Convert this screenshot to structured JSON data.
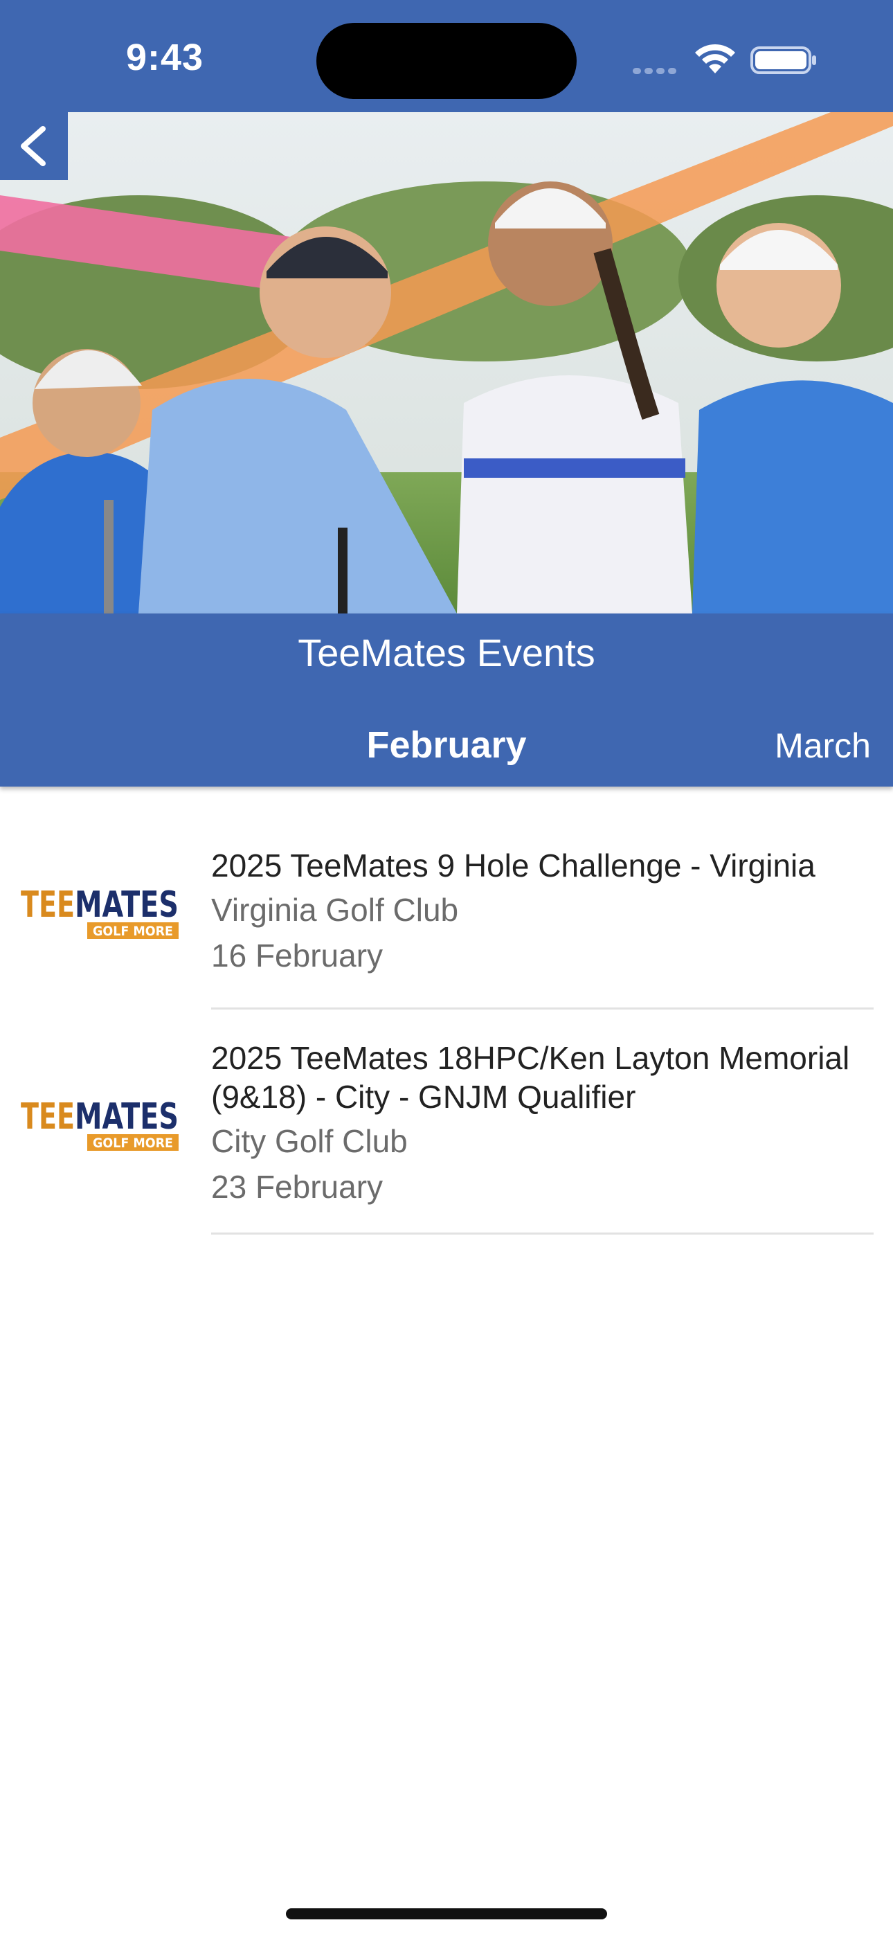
{
  "status_bar": {
    "time": "9:43"
  },
  "header": {
    "title": "TeeMates Events",
    "active_tab": "February",
    "next_tab": "March",
    "background_color": "#3f67b1"
  },
  "logo": {
    "main": "TEEMATES",
    "tagline": "GOLF MORE"
  },
  "events": [
    {
      "title": "2025 TeeMates 9 Hole Challenge - Virginia",
      "venue": "Virginia Golf Club",
      "date": "16 February"
    },
    {
      "title": "2025 TeeMates 18HPC/Ken Layton Memorial (9&18) - City - GNJM Qualifier",
      "venue": "City Golf Club",
      "date": "23 February"
    }
  ],
  "icons": {
    "back": "chevron-left-icon",
    "wifi": "wifi-icon",
    "battery": "battery-icon",
    "signal": "cellular-signal-icon"
  }
}
